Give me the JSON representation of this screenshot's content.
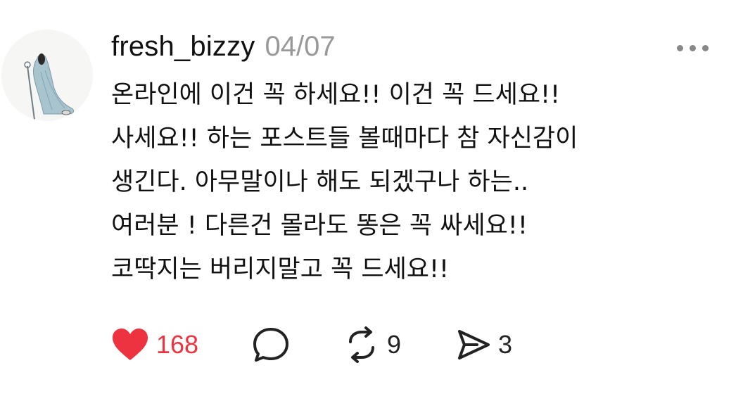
{
  "post": {
    "author": "fresh_bizzy",
    "date": "04/07",
    "body_lines": [
      "온라인에 이건 꼭 하세요!! 이건 꼭 드세요!!",
      "사세요!! 하는 포스트들 볼때마다 참 자신감이",
      "생긴다. 아무말이나 해도 되겠구나 하는..",
      "여러분 ! 다른건 몰라도 똥은 꼭 싸세요!!",
      "코딱지는 버리지말고 꼭 드세요!!"
    ]
  },
  "actions": {
    "like": {
      "icon": "heart-icon",
      "count": "168",
      "color": "#ee3340",
      "liked": true
    },
    "comment": {
      "icon": "speech-bubble-icon",
      "count": ""
    },
    "repost": {
      "icon": "repost-icon",
      "count": "9"
    },
    "share": {
      "icon": "paper-plane-icon",
      "count": "3"
    }
  },
  "menu": {
    "icon": "more-dots-icon"
  },
  "colors": {
    "text": "#111111",
    "muted": "#999999",
    "like": "#ee3340",
    "icon": "#222222"
  }
}
